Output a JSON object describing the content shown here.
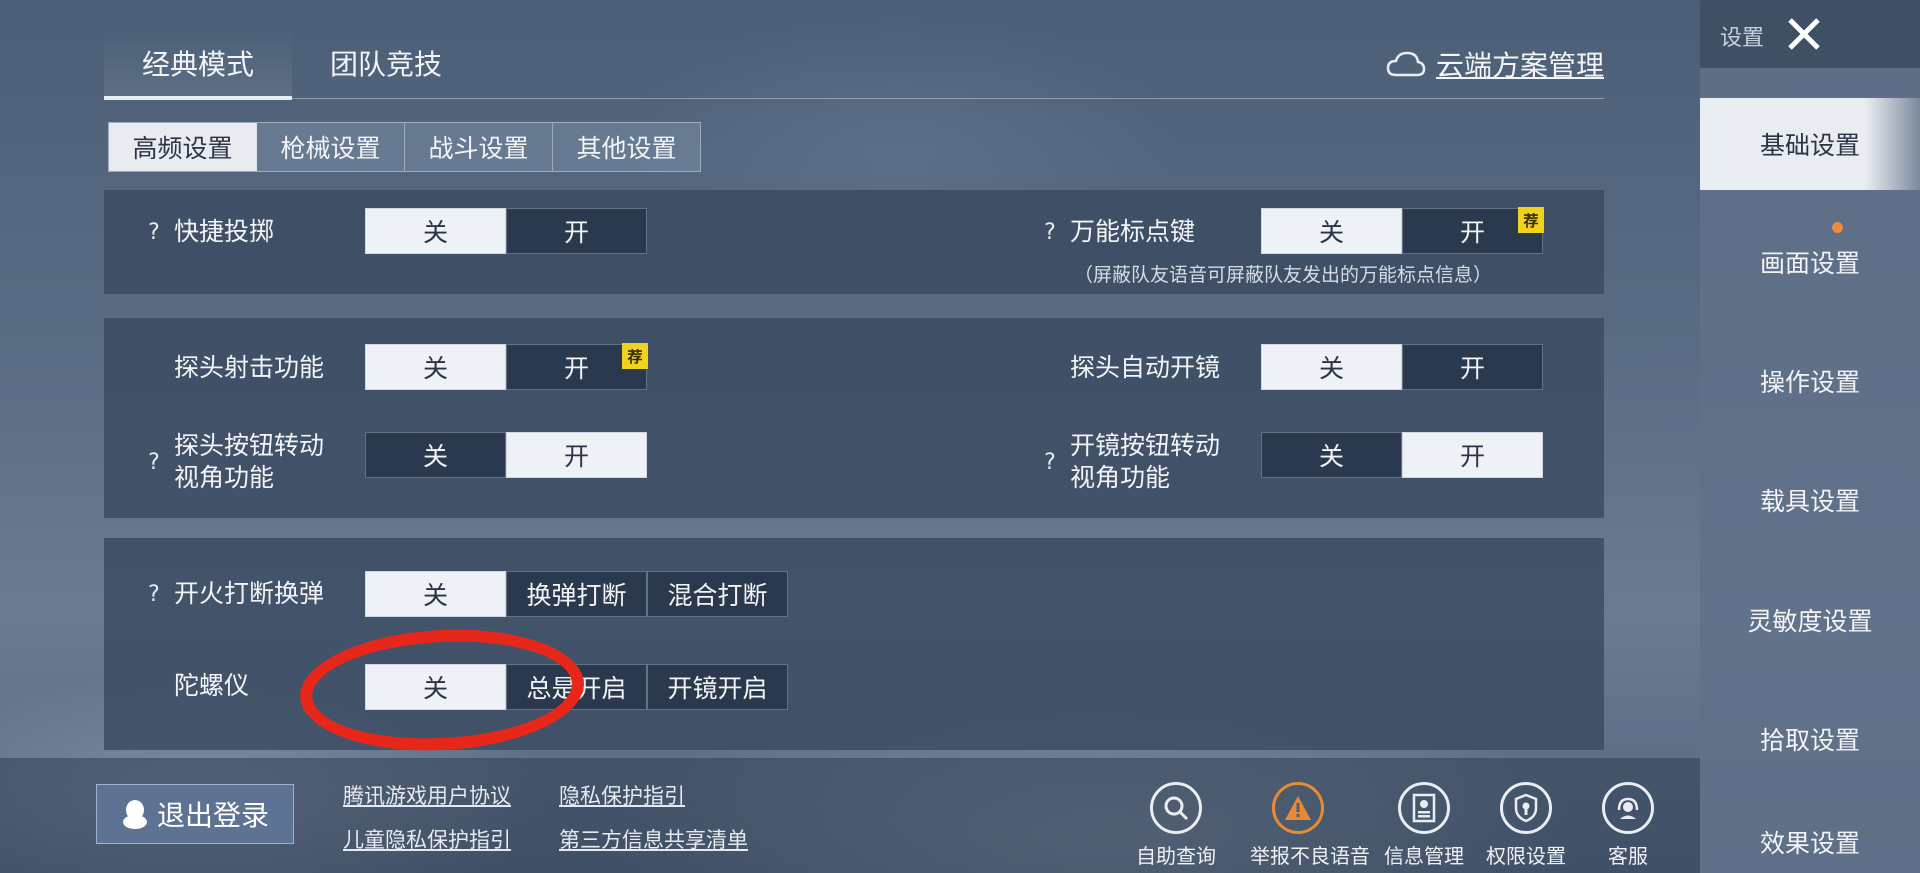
{
  "mode_tabs": [
    {
      "label": "经典模式",
      "active": true
    },
    {
      "label": "团队竞技",
      "active": false
    }
  ],
  "cloud_manage": "云端方案管理",
  "sub_tabs": [
    {
      "label": "高频设置",
      "active": true
    },
    {
      "label": "枪械设置",
      "active": false
    },
    {
      "label": "战斗设置",
      "active": false
    },
    {
      "label": "其他设置",
      "active": false
    }
  ],
  "help_mark": "?",
  "badge_text": "荐",
  "settings": {
    "quick_throw": {
      "label": "快捷投掷",
      "options": [
        "关",
        "开"
      ],
      "selected": "关"
    },
    "universal_mark": {
      "label": "万能标点键",
      "options": [
        "关",
        "开"
      ],
      "selected": "关",
      "hint": "（屏蔽队友语音可屏蔽队友发出的万能标点信息）"
    },
    "peek_shoot": {
      "label": "探头射击功能",
      "options": [
        "关",
        "开"
      ],
      "selected": "关"
    },
    "peek_auto_scope": {
      "label": "探头自动开镜",
      "options": [
        "关",
        "开"
      ],
      "selected": "关"
    },
    "peek_button_rotate": {
      "label_line1": "探头按钮转动",
      "label_line2": "视角功能",
      "options": [
        "关",
        "开"
      ],
      "selected": "开"
    },
    "scope_button_rotate": {
      "label_line1": "开镜按钮转动",
      "label_line2": "视角功能",
      "options": [
        "关",
        "开"
      ],
      "selected": "开"
    },
    "fire_interrupt_reload": {
      "label": "开火打断换弹",
      "options": [
        "关",
        "换弹打断",
        "混合打断"
      ],
      "selected": "关"
    },
    "gyroscope": {
      "label": "陀螺仪",
      "options": [
        "关",
        "总是开启",
        "开镜开启"
      ],
      "selected": "关"
    }
  },
  "bottom": {
    "logout": "退出登录",
    "links": [
      "腾讯游戏用户协议",
      "儿童隐私保护指引",
      "隐私保护指引",
      "第三方信息共享清单"
    ],
    "icons": [
      {
        "label": "自助查询",
        "icon": "search-icon"
      },
      {
        "label": "举报不良语音",
        "icon": "warning-icon"
      },
      {
        "label": "信息管理",
        "icon": "id-card-icon"
      },
      {
        "label": "权限设置",
        "icon": "shield-icon"
      },
      {
        "label": "客服",
        "icon": "headset-icon"
      }
    ]
  },
  "sidebar": {
    "title": "设置",
    "items": [
      "基础设置",
      "画面设置",
      "操作设置",
      "载具设置",
      "灵敏度设置",
      "拾取设置",
      "效果设置"
    ],
    "active": "基础设置"
  },
  "colors": {
    "annotation_ring": "#e8271b",
    "badge": "#f2d21c",
    "notify_dot": "#f08a3c"
  }
}
